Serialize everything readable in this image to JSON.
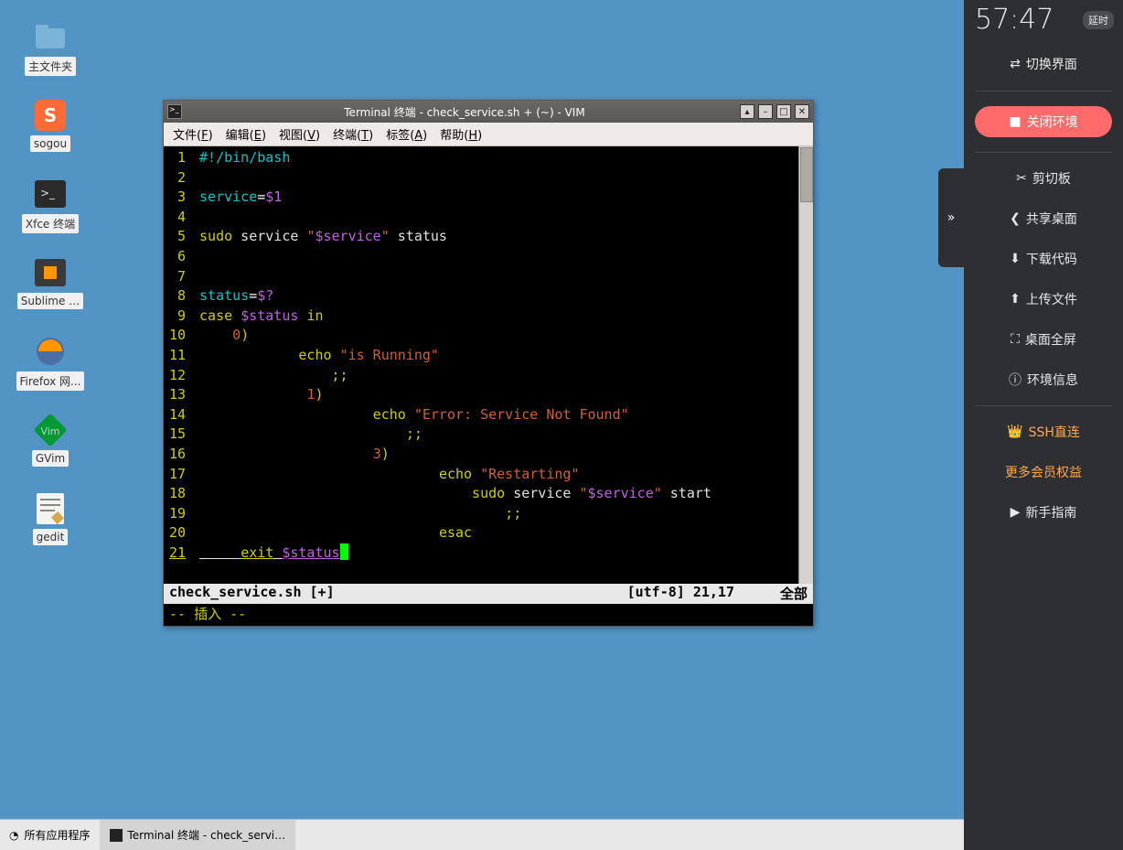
{
  "desktop_icons": [
    {
      "name": "home-folder",
      "label": "主文件夹"
    },
    {
      "name": "sogou",
      "label": "sogou"
    },
    {
      "name": "xfce-terminal",
      "label": "Xfce 终端"
    },
    {
      "name": "sublime",
      "label": "Sublime …"
    },
    {
      "name": "firefox",
      "label": "Firefox 网..."
    },
    {
      "name": "gvim",
      "label": "GVim"
    },
    {
      "name": "gedit",
      "label": "gedit"
    }
  ],
  "taskbar": {
    "apps_label": "所有应用程序",
    "task_label": "Terminal 终端 - check_servi…"
  },
  "sidebar": {
    "time": "57:47",
    "delay": "延时",
    "switch": "切换界面",
    "close": "关闭环境",
    "items": [
      {
        "icon": "✂",
        "label": "剪切板"
      },
      {
        "icon": "❮",
        "label": "共享桌面"
      },
      {
        "icon": "⬇",
        "label": "下载代码"
      },
      {
        "icon": "⬆",
        "label": "上传文件"
      },
      {
        "icon": "⛶",
        "label": "桌面全屏"
      },
      {
        "icon": "ⓘ",
        "label": "环境信息"
      }
    ],
    "ssh": "SSH直连",
    "member": "更多会员权益",
    "guide": "新手指南"
  },
  "window": {
    "title": "Terminal 终端 - check_service.sh + (~) - VIM",
    "menu": [
      "文件(F)",
      "编辑(E)",
      "视图(V)",
      "终端(T)",
      "标签(A)",
      "帮助(H)"
    ]
  },
  "vim": {
    "status_file": "check_service.sh [+]",
    "status_enc": "[utf-8] 21,17",
    "status_pos": "全部",
    "mode": "-- 插入 --",
    "lines": [
      {
        "n": 1,
        "seg": [
          {
            "c": "c-com",
            "t": "#!/bin/bash"
          }
        ]
      },
      {
        "n": 2,
        "seg": []
      },
      {
        "n": 3,
        "seg": [
          {
            "c": "c-id",
            "t": "service"
          },
          {
            "c": "c-op",
            "t": "="
          },
          {
            "c": "c-var",
            "t": "$1"
          }
        ]
      },
      {
        "n": 4,
        "seg": []
      },
      {
        "n": 5,
        "seg": [
          {
            "c": "c-kw",
            "t": "sudo"
          },
          {
            "c": "c-txt",
            "t": " service "
          },
          {
            "c": "c-str",
            "t": "\""
          },
          {
            "c": "c-var",
            "t": "$service"
          },
          {
            "c": "c-str",
            "t": "\""
          },
          {
            "c": "c-txt",
            "t": " status"
          }
        ]
      },
      {
        "n": 6,
        "seg": []
      },
      {
        "n": 7,
        "seg": []
      },
      {
        "n": 8,
        "seg": [
          {
            "c": "c-id",
            "t": "status"
          },
          {
            "c": "c-op",
            "t": "="
          },
          {
            "c": "c-var",
            "t": "$?"
          }
        ]
      },
      {
        "n": 9,
        "seg": [
          {
            "c": "c-kw",
            "t": "case"
          },
          {
            "c": "c-txt",
            "t": " "
          },
          {
            "c": "c-var",
            "t": "$status"
          },
          {
            "c": "c-txt",
            "t": " "
          },
          {
            "c": "c-kw",
            "t": "in"
          }
        ]
      },
      {
        "n": 10,
        "seg": [
          {
            "c": "c-txt",
            "t": "    "
          },
          {
            "c": "c-num",
            "t": "0"
          },
          {
            "c": "c-kw",
            "t": ")"
          }
        ]
      },
      {
        "n": 11,
        "seg": [
          {
            "c": "c-txt",
            "t": "            "
          },
          {
            "c": "c-kw",
            "t": "echo"
          },
          {
            "c": "c-txt",
            "t": " "
          },
          {
            "c": "c-str",
            "t": "\"is Running\""
          }
        ]
      },
      {
        "n": 12,
        "seg": [
          {
            "c": "c-txt",
            "t": "                "
          },
          {
            "c": "c-esc",
            "t": ";;"
          }
        ]
      },
      {
        "n": 13,
        "seg": [
          {
            "c": "c-txt",
            "t": "             "
          },
          {
            "c": "c-num",
            "t": "1"
          },
          {
            "c": "c-kw",
            "t": ")"
          }
        ]
      },
      {
        "n": 14,
        "seg": [
          {
            "c": "c-txt",
            "t": "                     "
          },
          {
            "c": "c-kw",
            "t": "echo"
          },
          {
            "c": "c-txt",
            "t": " "
          },
          {
            "c": "c-str",
            "t": "\"Error: Service Not Found\""
          }
        ]
      },
      {
        "n": 15,
        "seg": [
          {
            "c": "c-txt",
            "t": "                         "
          },
          {
            "c": "c-esc",
            "t": ";;"
          }
        ]
      },
      {
        "n": 16,
        "seg": [
          {
            "c": "c-txt",
            "t": "                     "
          },
          {
            "c": "c-num",
            "t": "3"
          },
          {
            "c": "c-kw",
            "t": ")"
          }
        ]
      },
      {
        "n": 17,
        "seg": [
          {
            "c": "c-txt",
            "t": "                             "
          },
          {
            "c": "c-kw",
            "t": "echo"
          },
          {
            "c": "c-txt",
            "t": " "
          },
          {
            "c": "c-str",
            "t": "\"Restarting\""
          }
        ]
      },
      {
        "n": 18,
        "seg": [
          {
            "c": "c-txt",
            "t": "                                 "
          },
          {
            "c": "c-kw",
            "t": "sudo"
          },
          {
            "c": "c-txt",
            "t": " service "
          },
          {
            "c": "c-str",
            "t": "\""
          },
          {
            "c": "c-var",
            "t": "$service"
          },
          {
            "c": "c-str",
            "t": "\""
          },
          {
            "c": "c-txt",
            "t": " start"
          }
        ]
      },
      {
        "n": 19,
        "seg": [
          {
            "c": "c-txt",
            "t": "                                     "
          },
          {
            "c": "c-esc",
            "t": ";;"
          }
        ]
      },
      {
        "n": 20,
        "seg": [
          {
            "c": "c-txt",
            "t": "                             "
          },
          {
            "c": "c-kw",
            "t": "esac"
          }
        ]
      },
      {
        "n": 21,
        "cur": true,
        "seg": [
          {
            "c": "c-txt",
            "t": "     "
          },
          {
            "c": "c-kw",
            "t": "exit"
          },
          {
            "c": "c-txt",
            "t": " "
          },
          {
            "c": "c-var",
            "t": "$status"
          }
        ]
      }
    ]
  }
}
